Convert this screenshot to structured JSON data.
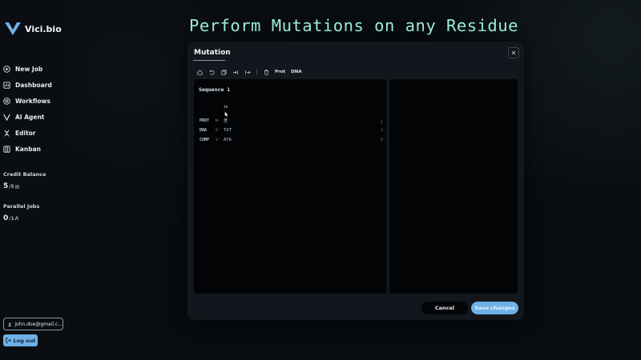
{
  "app": {
    "brand": "Vici.bio"
  },
  "headline": "Perform Mutations on any Residue",
  "sidebar": {
    "items": [
      {
        "label": "New Job",
        "icon": "plus-circle-icon"
      },
      {
        "label": "Dashboard",
        "icon": "dashboard-icon"
      },
      {
        "label": "Workflows",
        "icon": "workflow-icon"
      },
      {
        "label": "AI Agent",
        "icon": "ai-agent-icon"
      },
      {
        "label": "Editor",
        "icon": "dna-icon"
      },
      {
        "label": "Kanban",
        "icon": "kanban-icon"
      }
    ],
    "credit": {
      "label": "Credit Balance",
      "value": "5",
      "max": "/5"
    },
    "parallel": {
      "label": "Parallel Jobs",
      "value": "0",
      "max": "/1"
    },
    "user_email": "john.doe@gmail.c...",
    "logout_label": "Log out"
  },
  "modal": {
    "title": "Mutation",
    "toolbar": {
      "prot_label": "Prot",
      "dna_label": "DNA"
    },
    "sequence": {
      "title": "Sequence 1",
      "position": "46",
      "rows": [
        {
          "label": "PROT",
          "prefix": "N-",
          "seq": "Y",
          "suffix": "-C"
        },
        {
          "label": "DNA",
          "prefix": "5'",
          "seq": "TAT",
          "suffix": "3'"
        },
        {
          "label": "COMP",
          "prefix": "3'",
          "seq": "ATA",
          "suffix": "5'"
        }
      ]
    },
    "cancel_label": "Cancel",
    "save_label": "Save changes"
  },
  "colors": {
    "accent": "#6fb0e6",
    "headline": "#9ef0d8"
  }
}
